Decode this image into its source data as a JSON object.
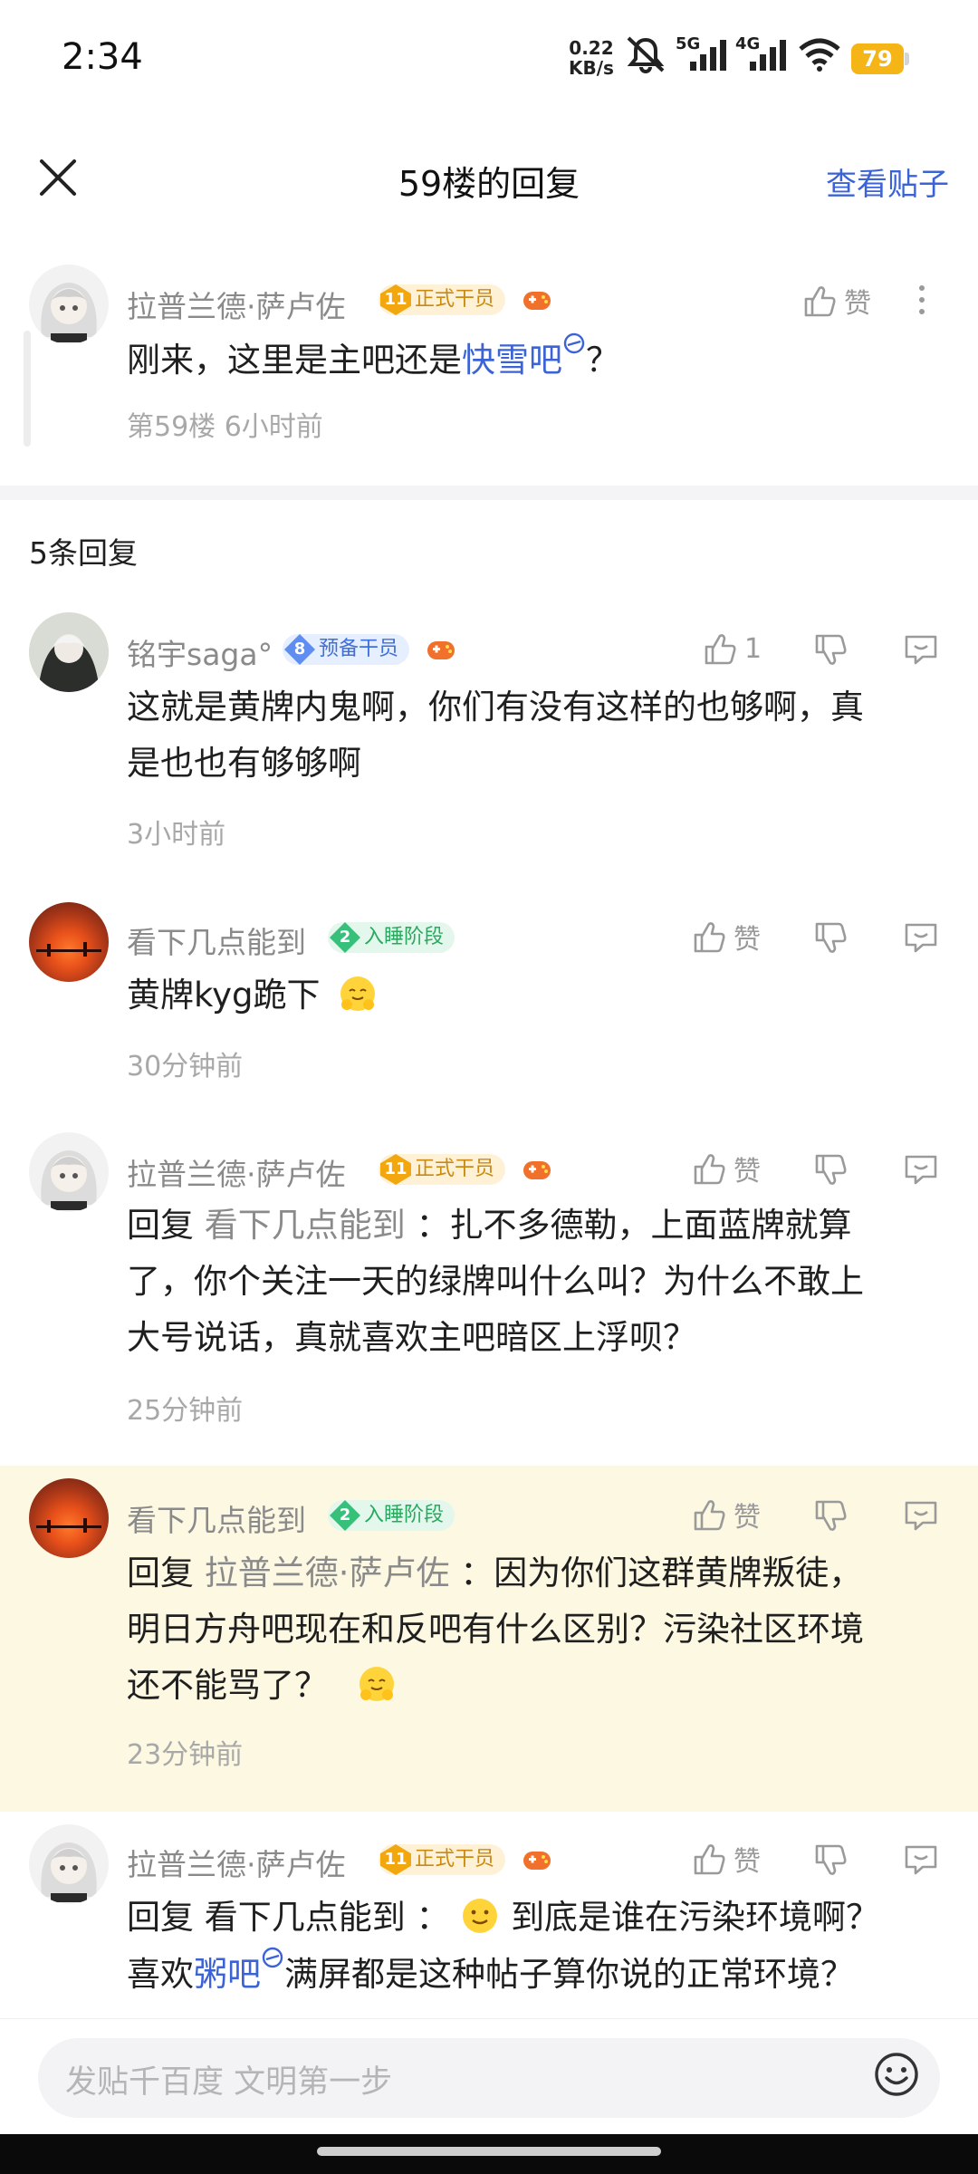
{
  "status_bar": {
    "time": "2:34",
    "net_speed_value": "0.22",
    "net_speed_unit": "KB/s",
    "net_5g": "5G",
    "net_4g": "4G",
    "battery": "79",
    "battery_color": "#f5b516"
  },
  "header": {
    "title": "59楼的回复",
    "view_post_label": "查看贴子",
    "close_icon": "close-icon"
  },
  "main_post": {
    "username": "拉普兰德·萨卢佐",
    "badge_level": "11",
    "badge_text": "正式干员",
    "like_label": "赞",
    "content_prefix": "刚来，这里是主吧还是",
    "content_link": "快雪吧",
    "content_suffix": "？",
    "meta": "第59楼 6小时前"
  },
  "reply_count": "5条回复",
  "replies": [
    {
      "username": "铭宇saga°",
      "badge_level": "8",
      "badge_text": "预备干员",
      "like_label": "1",
      "content_line1": "这就是黄牌内鬼啊，你们有没有这样的也够啊，真",
      "content_line2": "是也也有够够啊",
      "time": "3小时前"
    },
    {
      "username": "看下几点能到",
      "badge_level": "2",
      "badge_text": "入睡阶段",
      "like_label": "赞",
      "content_line1": "黄牌kyg跪下",
      "time": "30分钟前"
    },
    {
      "username": "拉普兰德·萨卢佐",
      "badge_level": "11",
      "badge_text": "正式干员",
      "like_label": "赞",
      "reply_prefix": "回复",
      "reply_target": "看下几点能到",
      "content_line1": "：扎不多德勒，上面蓝牌就算",
      "content_line2": "了，你个关注一天的绿牌叫什么叫？为什么不敢上",
      "content_line3": "大号说话，真就喜欢主吧暗区上浮呗？",
      "time": "25分钟前"
    },
    {
      "username": "看下几点能到",
      "badge_level": "2",
      "badge_text": "入睡阶段",
      "like_label": "赞",
      "reply_prefix": "回复",
      "reply_target": "拉普兰德·萨卢佐",
      "content_line1": "：因为你们这群黄牌叛徒，",
      "content_line2": "明日方舟吧现在和反吧有什么区别？污染社区环境",
      "content_line3": "还不能骂了？",
      "time": "23分钟前",
      "highlight_color": "#fdf8e2"
    },
    {
      "username": "拉普兰德·萨卢佐",
      "badge_level": "11",
      "badge_text": "正式干员",
      "like_label": "赞",
      "reply_prefix": "回复",
      "reply_target": "看下几点能到",
      "content_line1": "：",
      "content_line1b": "到底是谁在污染环境啊？",
      "content_line2_prefix": "喜欢",
      "content_line2_link": "粥吧",
      "content_line2_suffix": "满屏都是这种帖子算你说的正常环境？"
    }
  ],
  "input": {
    "placeholder": "发贴千百度 文明第一步",
    "emoji_icon": "smiley-icon"
  },
  "colors": {
    "link": "#3b63d6",
    "meta": "#a8a8a8",
    "username": "#8a8a8a"
  }
}
